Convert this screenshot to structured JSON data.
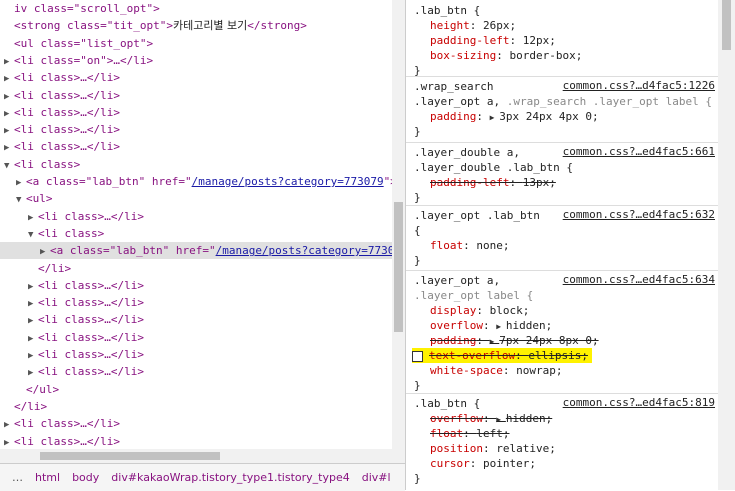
{
  "elements": {
    "rows": [
      {
        "indent": 0,
        "tri": "",
        "html": [
          [
            "tag",
            "iv class=\"scroll_opt\">"
          ]
        ]
      },
      {
        "indent": 0,
        "tri": "",
        "html": [
          [
            "tag",
            "<strong class=\"tit_opt\">"
          ],
          [
            "txt",
            "카테고리별 보기"
          ],
          [
            "tag",
            "</strong>"
          ]
        ]
      },
      {
        "indent": 0,
        "tri": "",
        "html": [
          [
            "tag",
            "<ul class=\"list_opt\">"
          ]
        ]
      },
      {
        "indent": 0,
        "tri": "▶",
        "html": [
          [
            "tag",
            "<li class=\"on\">…</li>"
          ]
        ]
      },
      {
        "indent": 0,
        "tri": "▶",
        "html": [
          [
            "tag",
            "<li class>…</li>"
          ]
        ]
      },
      {
        "indent": 0,
        "tri": "▶",
        "html": [
          [
            "tag",
            "<li class>…</li>"
          ]
        ]
      },
      {
        "indent": 0,
        "tri": "▶",
        "html": [
          [
            "tag",
            "<li class>…</li>"
          ]
        ]
      },
      {
        "indent": 0,
        "tri": "▶",
        "html": [
          [
            "tag",
            "<li class>…</li>"
          ]
        ]
      },
      {
        "indent": 0,
        "tri": "▶",
        "html": [
          [
            "tag",
            "<li class>…</li>"
          ]
        ]
      },
      {
        "indent": 0,
        "tri": "▼",
        "html": [
          [
            "tag",
            "<li class>"
          ]
        ]
      },
      {
        "indent": 1,
        "tri": "▶",
        "html": [
          [
            "tag",
            "<a class=\"lab_btn\" href=\""
          ],
          [
            "link",
            "/manage/posts?category=773079"
          ],
          [
            "tag",
            "\">"
          ]
        ]
      },
      {
        "indent": 1,
        "tri": "▼",
        "html": [
          [
            "tag",
            "<ul>"
          ]
        ]
      },
      {
        "indent": 2,
        "tri": "▶",
        "html": [
          [
            "tag",
            "<li class>…</li>"
          ]
        ]
      },
      {
        "indent": 2,
        "tri": "▼",
        "html": [
          [
            "tag",
            "<li class>"
          ]
        ]
      },
      {
        "indent": 3,
        "tri": "▶",
        "html": [
          [
            "tag",
            "<a class=\"lab_btn\" href=\""
          ],
          [
            "link",
            "/manage/posts?category=7730"
          ]
        ],
        "sel": true
      },
      {
        "indent": 2,
        "tri": "",
        "html": [
          [
            "tag",
            "</li>"
          ]
        ]
      },
      {
        "indent": 2,
        "tri": "▶",
        "html": [
          [
            "tag",
            "<li class>…</li>"
          ]
        ]
      },
      {
        "indent": 2,
        "tri": "▶",
        "html": [
          [
            "tag",
            "<li class>…</li>"
          ]
        ]
      },
      {
        "indent": 2,
        "tri": "▶",
        "html": [
          [
            "tag",
            "<li class>…</li>"
          ]
        ]
      },
      {
        "indent": 2,
        "tri": "▶",
        "html": [
          [
            "tag",
            "<li class>…</li>"
          ]
        ]
      },
      {
        "indent": 2,
        "tri": "▶",
        "html": [
          [
            "tag",
            "<li class>…</li>"
          ]
        ]
      },
      {
        "indent": 2,
        "tri": "▶",
        "html": [
          [
            "tag",
            "<li class>…</li>"
          ]
        ]
      },
      {
        "indent": 1,
        "tri": "",
        "html": [
          [
            "tag",
            "</ul>"
          ]
        ]
      },
      {
        "indent": 0,
        "tri": "",
        "html": [
          [
            "tag",
            "</li>"
          ]
        ]
      },
      {
        "indent": 0,
        "tri": "▶",
        "html": [
          [
            "tag",
            "<li class>…</li>"
          ]
        ]
      },
      {
        "indent": 0,
        "tri": "▶",
        "html": [
          [
            "tag",
            "<li class>…</li>"
          ]
        ]
      }
    ]
  },
  "breadcrumb": [
    "…",
    "html",
    "body",
    "div#kakaoWrap.tistory_type1.tistory_type4",
    "div#l"
  ],
  "styles": {
    "rules": [
      {
        "selectors": [
          [
            ".lab_btn {",
            ""
          ]
        ],
        "source": "",
        "props": [
          {
            "name": "height",
            "value": "26px;"
          },
          {
            "name": "padding-left",
            "value": "12px;"
          },
          {
            "name": "box-sizing",
            "value": "border-box;"
          }
        ]
      },
      {
        "selectors": [
          [
            ".wrap_search",
            ""
          ],
          [
            ".layer_opt a,",
            ".wrap_search .layer_opt label {"
          ]
        ],
        "source": "common.css?…d4fac5:1226",
        "props": [
          {
            "name": "padding",
            "value": "3px 24px 4px 0;",
            "arrow": true
          }
        ]
      },
      {
        "selectors": [
          [
            ".layer_double a,",
            ""
          ],
          [
            ".layer_double .lab_btn {",
            ""
          ]
        ],
        "source": "common.css?…ed4fac5:661",
        "props": [
          {
            "name": "padding-left",
            "value": "13px;",
            "strike": true
          }
        ]
      },
      {
        "selectors": [
          [
            ".layer_opt .lab_btn",
            ""
          ]
        ],
        "source": "common.css?…ed4fac5:632",
        "props": [
          {
            "name": "float",
            "value": "none;"
          }
        ]
      },
      {
        "selectors": [
          [
            ".layer_opt a,",
            ""
          ],
          [
            "",
            ".layer_opt label {"
          ]
        ],
        "source": "common.css?…ed4fac5:634",
        "props": [
          {
            "name": "display",
            "value": "block;"
          },
          {
            "name": "overflow",
            "value": "hidden;",
            "arrow": true
          },
          {
            "name": "padding",
            "value": "7px 24px 8px 0;",
            "arrow": true,
            "strike": true
          },
          {
            "name": "text-overflow",
            "value": "ellipsis;",
            "strike": true,
            "highlight": true
          },
          {
            "name": "white-space",
            "value": "nowrap;"
          }
        ]
      },
      {
        "selectors": [
          [
            ".lab_btn {",
            ""
          ]
        ],
        "source": "common.css?…ed4fac5:819",
        "props": [
          {
            "name": "overflow",
            "value": "hidden;",
            "arrow": true,
            "strike": true
          },
          {
            "name": "float",
            "value": "left;",
            "strike": true
          },
          {
            "name": "position",
            "value": "relative;"
          },
          {
            "name": "cursor",
            "value": "pointer;"
          }
        ]
      }
    ]
  }
}
